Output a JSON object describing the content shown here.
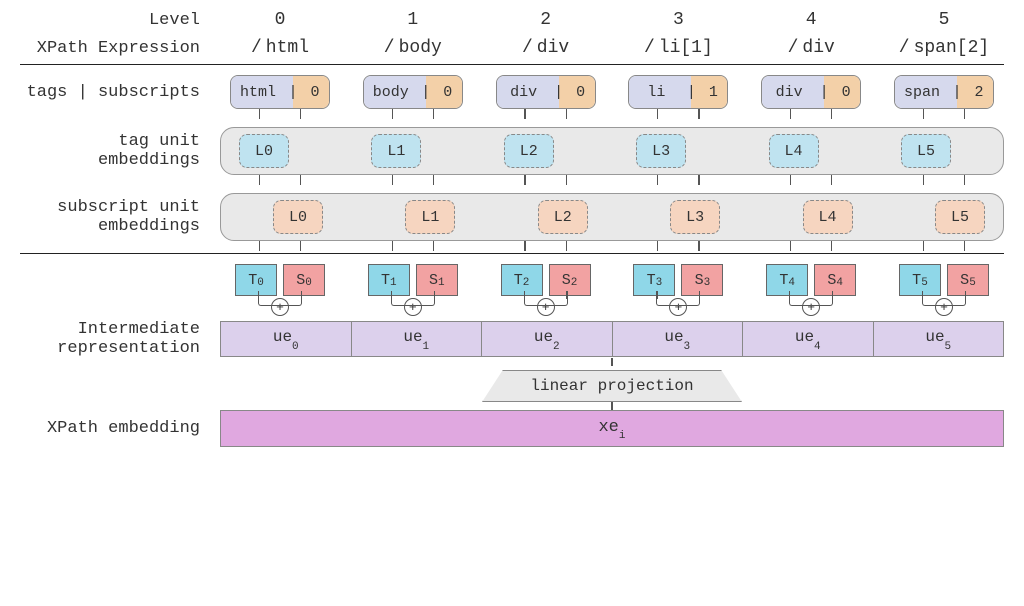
{
  "labels": {
    "level": "Level",
    "xpath_expression": "XPath Expression",
    "tags_subscripts": "tags | subscripts",
    "tag_unit_embeddings": "tag unit\nembeddings",
    "subscript_unit_embeddings": "subscript unit\nembeddings",
    "intermediate_representation": "Intermediate\nrepresentation",
    "xpath_embedding": "XPath embedding",
    "linear_projection": "linear projection"
  },
  "levels": [
    "0",
    "1",
    "2",
    "3",
    "4",
    "5"
  ],
  "xpath_tokens": [
    "html",
    "body",
    "div",
    "li[1]",
    "div",
    "span[2]"
  ],
  "tag_sub": [
    {
      "tag": "html",
      "sub": "0"
    },
    {
      "tag": "body",
      "sub": "0"
    },
    {
      "tag": "div",
      "sub": "0"
    },
    {
      "tag": "li",
      "sub": "1"
    },
    {
      "tag": "div",
      "sub": "0"
    },
    {
      "tag": "span",
      "sub": "2"
    }
  ],
  "tag_unit_labels": [
    "L0",
    "L1",
    "L2",
    "L3",
    "L4",
    "L5"
  ],
  "sub_unit_labels": [
    "L0",
    "L1",
    "L2",
    "L3",
    "L4",
    "L5"
  ],
  "T_labels": [
    "T",
    "T",
    "T",
    "T",
    "T",
    "T"
  ],
  "S_labels": [
    "S",
    "S",
    "S",
    "S",
    "S",
    "S"
  ],
  "ue_labels": [
    "ue",
    "ue",
    "ue",
    "ue",
    "ue",
    "ue"
  ],
  "xe_label": "xe",
  "xe_subscript": "i",
  "plus_symbol": "+"
}
